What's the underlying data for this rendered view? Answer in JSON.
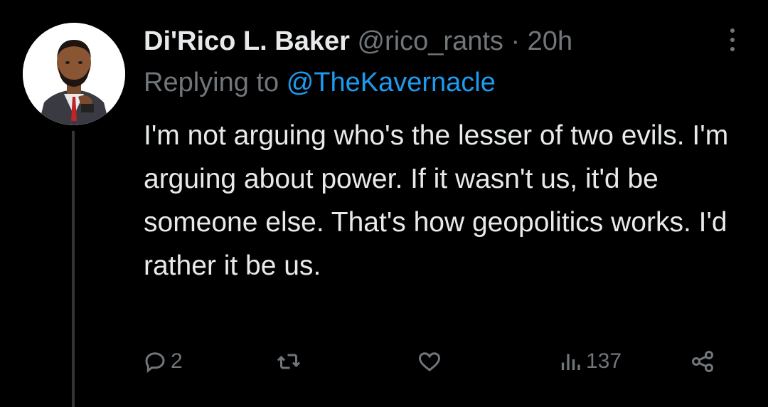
{
  "post": {
    "author_name": "Di'Rico L. Baker",
    "handle": "@rico_rants",
    "separator": "·",
    "time": "20h",
    "replying_prefix": "Replying to",
    "replying_to": "@TheKavernacle",
    "text": "I'm not arguing who's the lesser of two evils. I'm arguing about power. If it wasn't us, it'd be someone else. That's how geopolitics works. I'd rather it be us."
  },
  "actions": {
    "reply_count": "2",
    "retweet_count": "",
    "like_count": "",
    "views_count": "137"
  },
  "icons": {
    "reply": "reply-icon",
    "retweet": "retweet-icon",
    "like": "heart-icon",
    "views": "views-icon",
    "share": "share-icon",
    "more": "more-icon"
  },
  "colors": {
    "background": "#000000",
    "text": "#e7e9ea",
    "secondary": "#71767b",
    "link": "#1d9bf0",
    "thread_line": "#333639"
  }
}
